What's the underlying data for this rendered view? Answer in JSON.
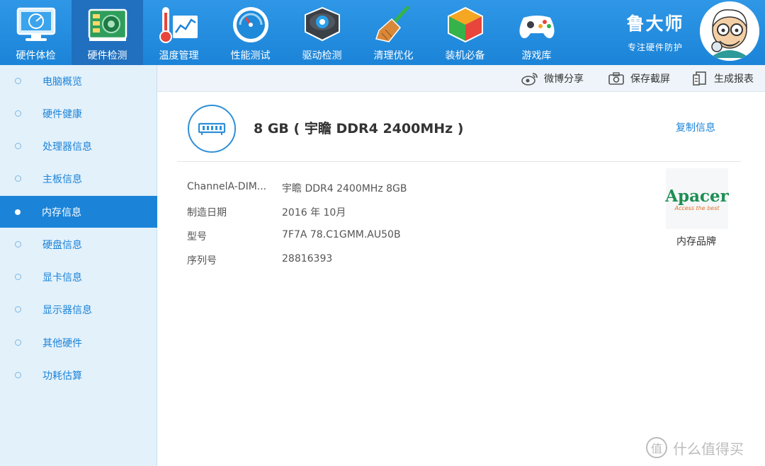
{
  "app": {
    "brand_name": "鲁大师",
    "brand_slogan": "专注硬件防护"
  },
  "toolbar": {
    "items": [
      {
        "label": "硬件体检",
        "icon": "monitor-check-icon"
      },
      {
        "label": "硬件检测",
        "icon": "circuit-board-icon"
      },
      {
        "label": "温度管理",
        "icon": "thermometer-chart-icon"
      },
      {
        "label": "性能测试",
        "icon": "speedometer-icon"
      },
      {
        "label": "驱动检测",
        "icon": "gear-drive-icon"
      },
      {
        "label": "清理优化",
        "icon": "broom-icon"
      },
      {
        "label": "装机必备",
        "icon": "cube-box-icon"
      },
      {
        "label": "游戏库",
        "icon": "gamepad-icon"
      }
    ],
    "active_index": 1
  },
  "sidebar": {
    "items": [
      {
        "label": "电脑概览"
      },
      {
        "label": "硬件健康"
      },
      {
        "label": "处理器信息"
      },
      {
        "label": "主板信息"
      },
      {
        "label": "内存信息"
      },
      {
        "label": "硬盘信息"
      },
      {
        "label": "显卡信息"
      },
      {
        "label": "显示器信息"
      },
      {
        "label": "其他硬件"
      },
      {
        "label": "功耗估算"
      }
    ],
    "active_index": 4
  },
  "actions": {
    "share": "微博分享",
    "screenshot": "保存截屏",
    "report": "生成报表"
  },
  "memory": {
    "title": "8 GB ( 宇瞻 DDR4 2400MHz )",
    "copy_label": "复制信息",
    "rows": [
      {
        "key": "ChannelA-DIM...",
        "value": "宇瞻 DDR4 2400MHz 8GB"
      },
      {
        "key": "制造日期",
        "value": "2016 年 10月"
      },
      {
        "key": "型号",
        "value": "7F7A 78.C1GMM.AU50B"
      },
      {
        "key": "序列号",
        "value": "28816393"
      }
    ],
    "brand_logo_text": "Apacer",
    "brand_logo_tagline": "Access the best",
    "brand_caption": "内存品牌"
  },
  "watermark": {
    "text": "什么值得买",
    "icon_glyph": "值"
  },
  "colors": {
    "toolbar_blue": "#1c84d8",
    "sidebar_bg": "#e3f1fb",
    "accent": "#1c84d8",
    "apacer_green": "#1d8f53",
    "apacer_orange": "#e0732a"
  }
}
